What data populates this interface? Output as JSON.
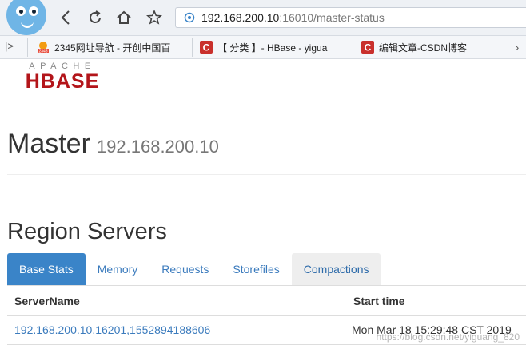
{
  "browser": {
    "url_host": "192.168.200.10",
    "url_rest": ":16010/master-status",
    "bookmarks": [
      {
        "label": "2345网址导航 - 开创中国百",
        "icon": "2345-icon",
        "icon_text": "2345"
      },
      {
        "label": "【 分类 】- HBase - yigua",
        "icon": "csdn-c-icon",
        "icon_text": "C"
      },
      {
        "label": "编辑文章-CSDN博客",
        "icon": "csdn-c-icon",
        "icon_text": "C"
      }
    ],
    "bookmark_toggle": "|>",
    "bookmark_more": "›"
  },
  "logo": {
    "top": "APACHE",
    "main": "HBASE"
  },
  "page": {
    "title": "Master",
    "subtitle": "192.168.200.10"
  },
  "region_servers": {
    "title": "Region Servers",
    "tabs": [
      "Base Stats",
      "Memory",
      "Requests",
      "Storefiles",
      "Compactions"
    ],
    "columns": [
      "ServerName",
      "Start time"
    ],
    "rows": [
      {
        "server": "192.168.200.10,16201,1552894188606",
        "start": "Mon Mar 18 15:29:48 CST 2019"
      }
    ]
  },
  "watermark": "https://blog.csdn.net/yiguang_820",
  "colors": {
    "accent": "#3a84c8",
    "logo_red": "#b3151a",
    "link": "#3b7bbd"
  }
}
